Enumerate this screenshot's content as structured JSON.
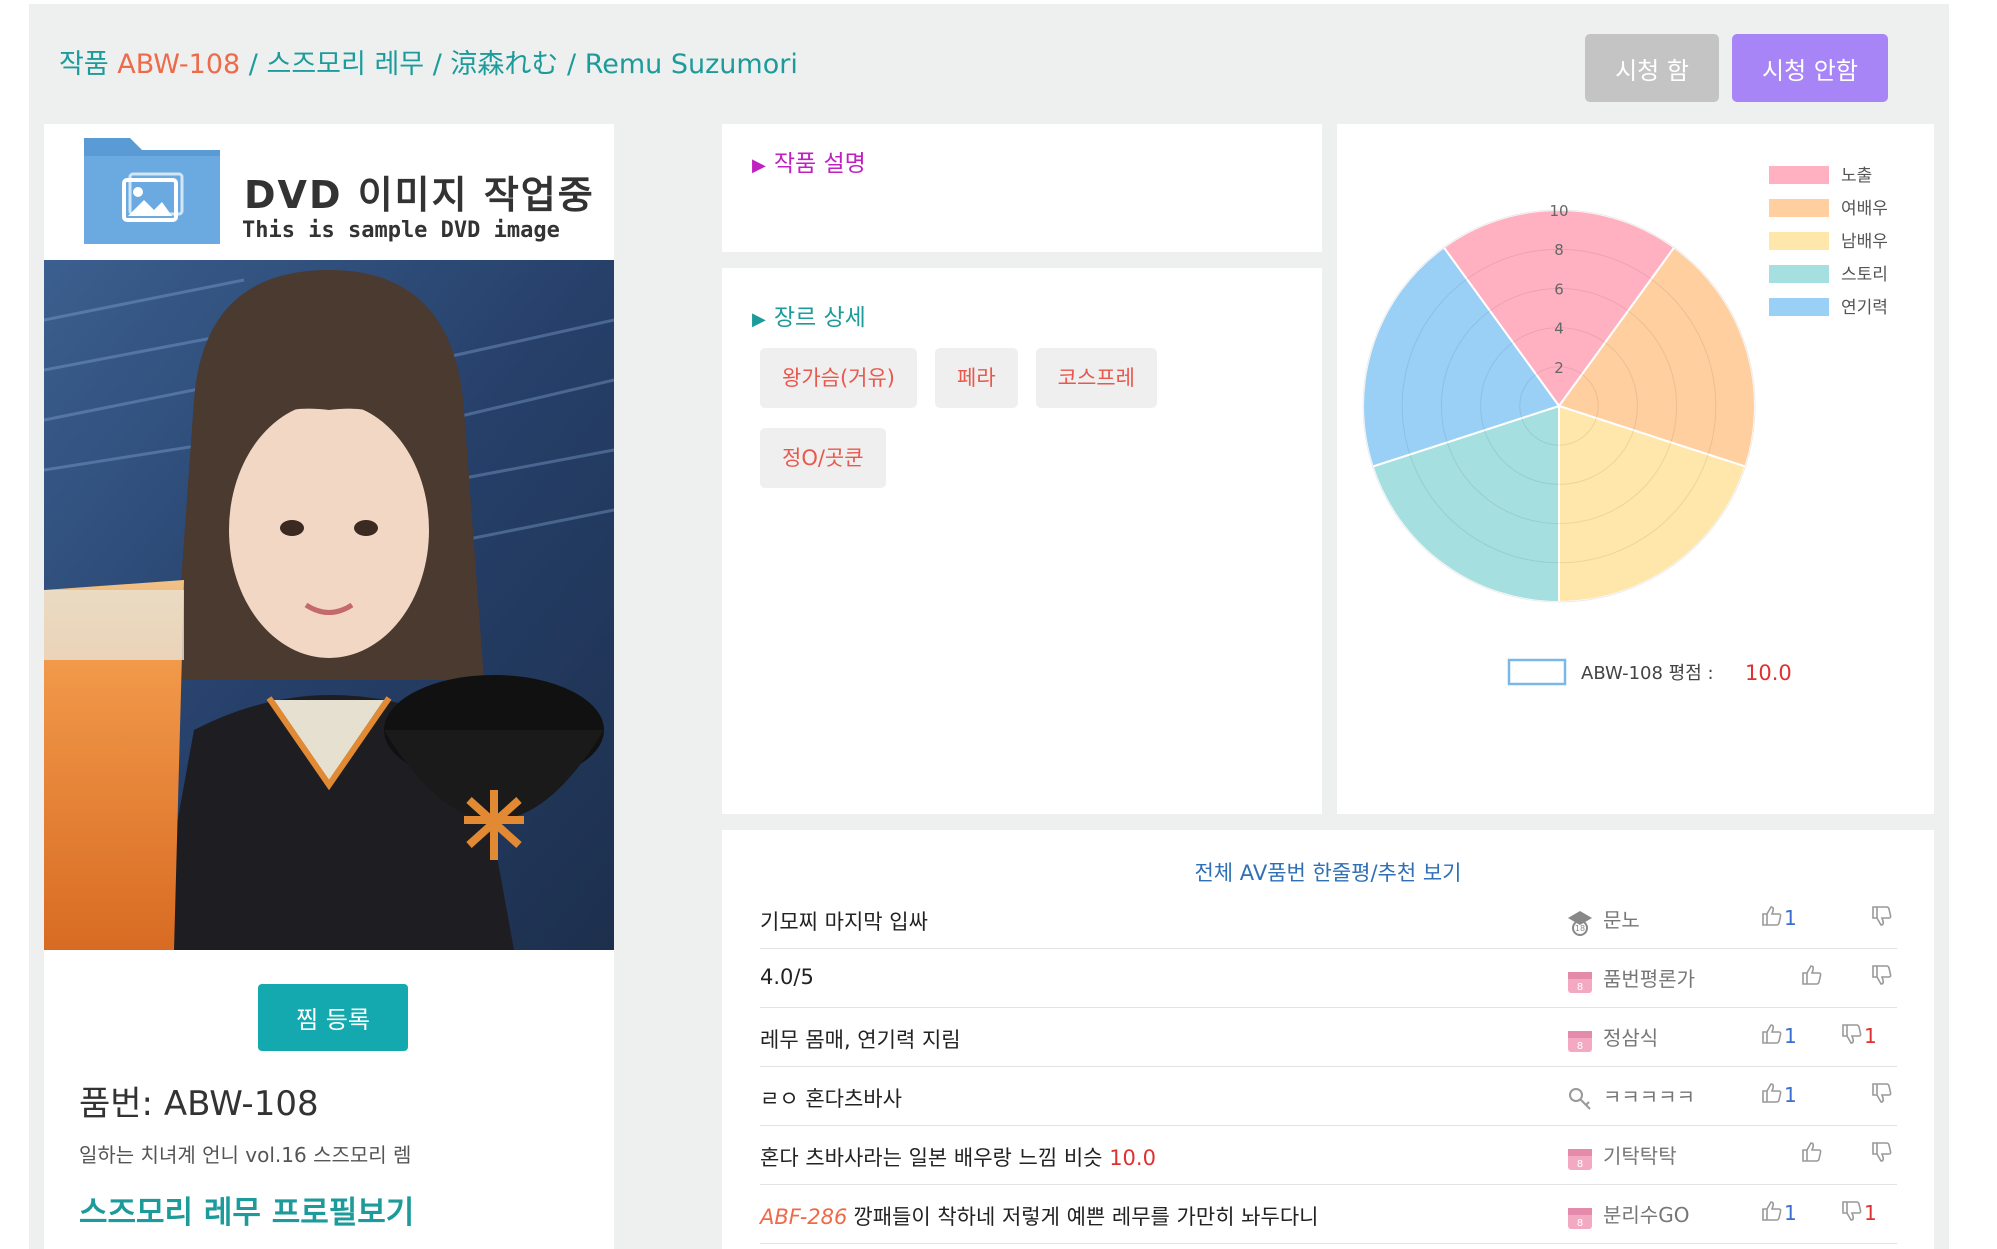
{
  "header": {
    "prefix": "작품",
    "code": "ABW-108",
    "sep1": "/",
    "name_kr": "스즈모리 레무",
    "sep2": "/",
    "name_jp": "涼森れむ",
    "sep3": "/",
    "name_en": "Remu Suzumori",
    "btn_watched": "시청 함",
    "btn_not_watched": "시청 안함"
  },
  "left": {
    "dvd_title": "DVD 이미지 작업중",
    "dvd_subtitle": "This is sample DVD image",
    "zzim_button": "찜 등록",
    "product_code": "품번: ABW-108",
    "product_title": "일하는 치녀계 언니 vol.16 스즈모리 렘",
    "profile_link": "스즈모리 레무 프로필보기"
  },
  "description": {
    "title": "작품 설명"
  },
  "genre": {
    "title": "장르 상세",
    "tags": [
      "왕가슴(거유)",
      "페라",
      "코스프레",
      "정O/곳쿤"
    ]
  },
  "chart_data": {
    "type": "polar-area",
    "categories": [
      "노출",
      "여배우",
      "남배우",
      "스토리",
      "연기력"
    ],
    "values": [
      10,
      10,
      10,
      10,
      10
    ],
    "colors": [
      "#ffb1c1",
      "#ffcf9f",
      "#ffe6aa",
      "#a5dfdf",
      "#9ad0f5"
    ],
    "rlim": [
      0,
      10
    ],
    "ticks": [
      "2",
      "4",
      "6",
      "8",
      "10"
    ],
    "legend_position": "top-right",
    "score_label": "ABW-108 평점 :",
    "score_value": "10.0"
  },
  "comments": {
    "all_link": "전체 AV품번 한줄평/추천 보기",
    "rows": [
      {
        "ref": "",
        "text": "기모찌 마지막 입싸",
        "score": "",
        "user": "문노",
        "badge": "18-icon",
        "up": "1",
        "down": ""
      },
      {
        "ref": "",
        "text": "4.0/5",
        "score": "",
        "user": "품번평론가",
        "badge": "level-badge-icon",
        "up": "",
        "down": ""
      },
      {
        "ref": "",
        "text": "레무 몸매, 연기력 지림",
        "score": "",
        "user": "정삼식",
        "badge": "level-badge-icon",
        "up": "1",
        "down": "1"
      },
      {
        "ref": "",
        "text": "ㄹㅇ 혼다츠바사",
        "score": "",
        "user": "ㅋㅋㅋㅋㅋ",
        "badge": "key-icon",
        "up": "1",
        "down": ""
      },
      {
        "ref": "",
        "text": "혼다 츠바사라는 일본 배우랑 느낌 비슷",
        "score": "10.0",
        "user": "기탁탁탁",
        "badge": "level-badge-icon",
        "up": "",
        "down": ""
      },
      {
        "ref": "ABF-286",
        "text": "깡패들이 착하네 저렇게 예쁜 레무를 가만히 놔두다니",
        "score": "",
        "user": "분리수GO",
        "badge": "level-badge-icon",
        "up": "1",
        "down": "1"
      }
    ]
  }
}
